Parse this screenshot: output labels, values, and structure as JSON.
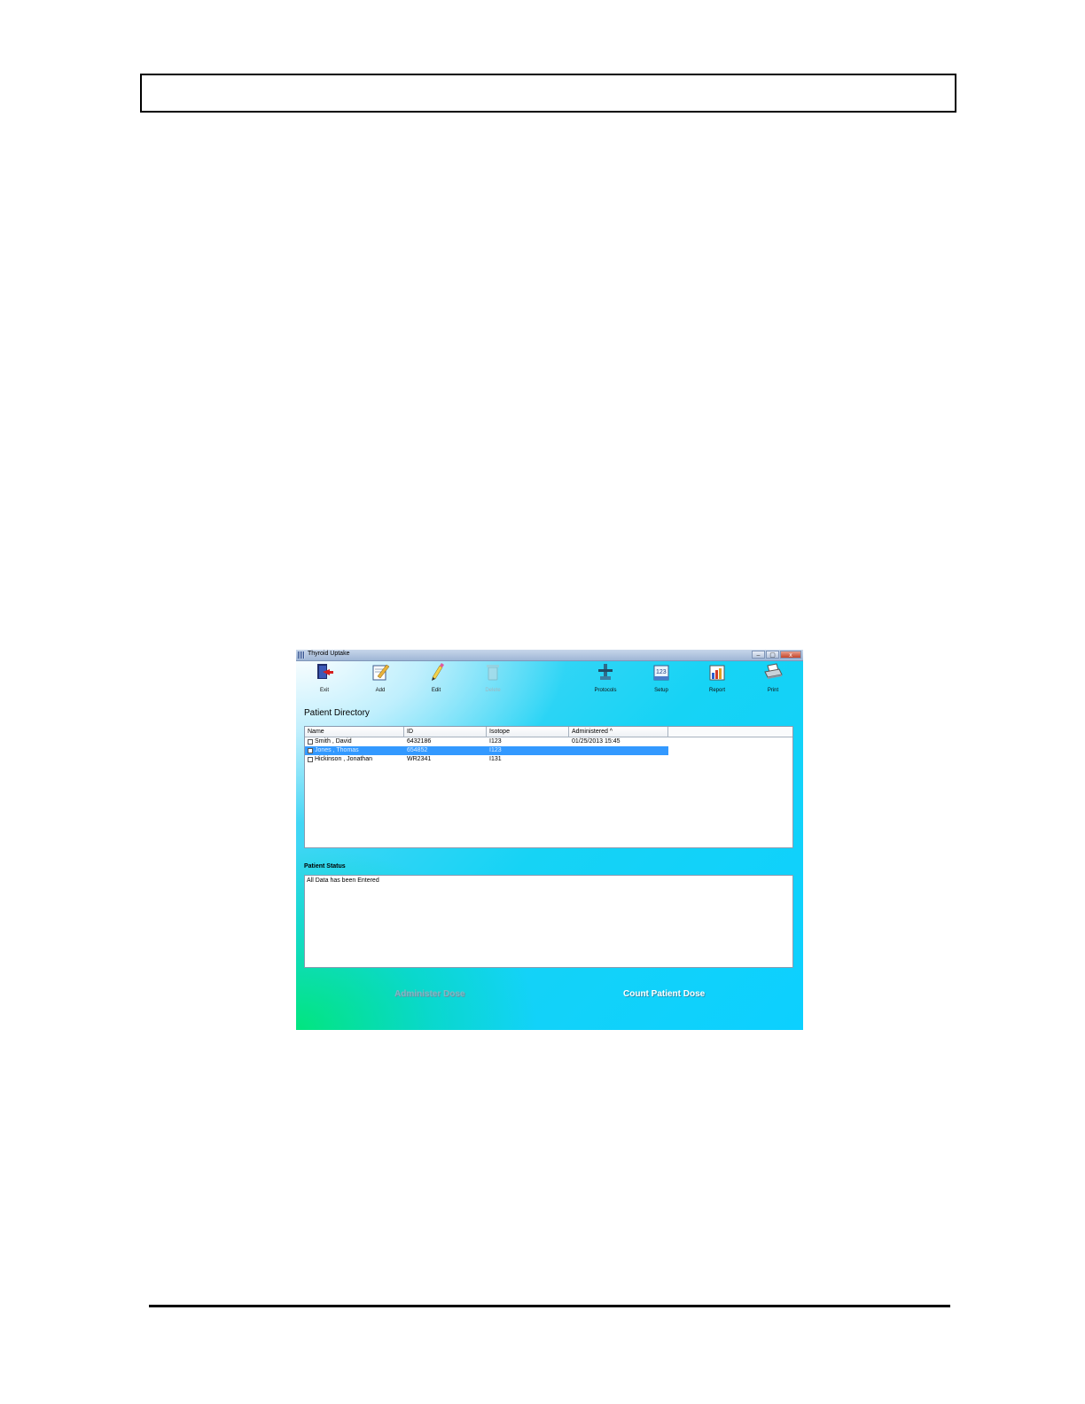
{
  "window": {
    "title": "Thyroid Uptake",
    "controls": {
      "minimize": "–",
      "maximize": "▢",
      "close": "x"
    }
  },
  "toolbar": {
    "items": [
      {
        "label": "Exit",
        "icon": "exit-icon",
        "enabled": true
      },
      {
        "label": "Add",
        "icon": "add-icon",
        "enabled": true
      },
      {
        "label": "Edit",
        "icon": "edit-icon",
        "enabled": true
      },
      {
        "label": "Delete",
        "icon": "delete-icon",
        "enabled": false
      },
      {
        "label": "Protocols",
        "icon": "protocols-icon",
        "enabled": true
      },
      {
        "label": "Setup",
        "icon": "setup-icon",
        "enabled": true
      },
      {
        "label": "Report",
        "icon": "report-icon",
        "enabled": true
      },
      {
        "label": "Print",
        "icon": "print-icon",
        "enabled": true
      }
    ]
  },
  "patient_directory": {
    "title": "Patient Directory",
    "columns": [
      "Name",
      "ID",
      "Isotope",
      "Administered ^"
    ],
    "rows": [
      {
        "name": "Smith , David",
        "id": "6432186",
        "isotope": "I123",
        "administered": "01/25/2013   15:45",
        "selected": false
      },
      {
        "name": "Jones , Thomas",
        "id": "654852",
        "isotope": "I123",
        "administered": "",
        "selected": true
      },
      {
        "name": "Hickinson , Jonathan",
        "id": "WR2341",
        "isotope": "I131",
        "administered": "",
        "selected": false
      }
    ]
  },
  "patient_status": {
    "title": "Patient Status",
    "text": "All Data has been Entered"
  },
  "actions": {
    "administer_dose": "Administer Dose",
    "count_patient_dose": "Count Patient Dose"
  },
  "colors": {
    "selection": "#3399ff",
    "background_accent": "#0cd0ff"
  }
}
